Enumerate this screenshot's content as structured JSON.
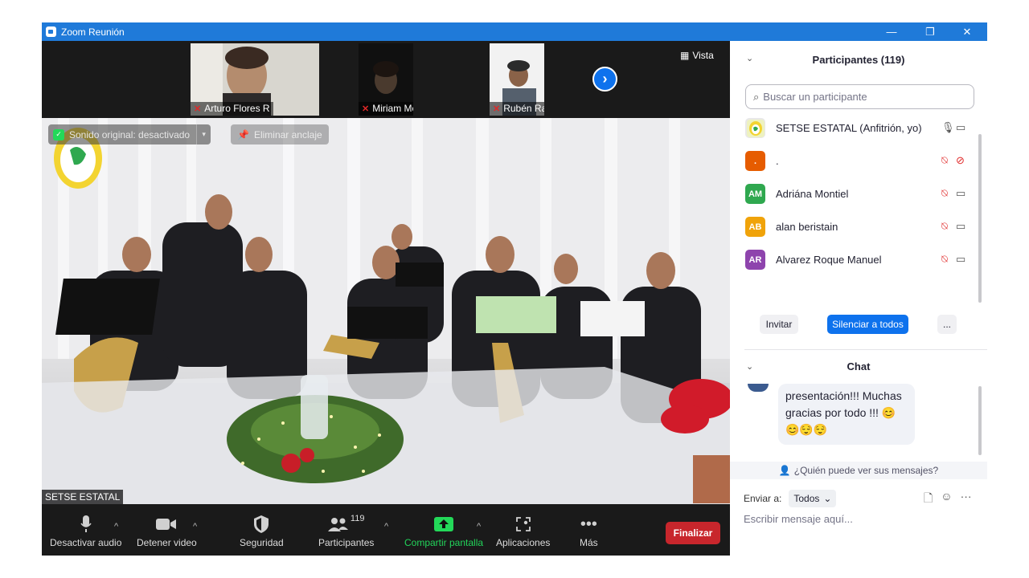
{
  "window": {
    "title": "Zoom Reunión",
    "minimize": "—",
    "restore": "❐",
    "close": "✕"
  },
  "gallery_strip": {
    "tiles": [
      {
        "name": "Arturo Flores R"
      },
      {
        "name": "Miriam Meza"
      },
      {
        "name": "Rubén Ramírez"
      }
    ],
    "next_arrow": "›",
    "view_label": "Vista"
  },
  "main_video": {
    "speaker_name": "SETSE ESTATAL",
    "sound_pill": "Sonido original: desactivado",
    "unpin_label": "Eliminar anclaje"
  },
  "toolbar": {
    "mute": "Desactivar audio",
    "video": "Detener video",
    "security": "Seguridad",
    "participants": "Participantes",
    "participants_count": "119",
    "share": "Compartir pantalla",
    "apps": "Aplicaciones",
    "more": "Más",
    "end": "Finalizar"
  },
  "participants_panel": {
    "header": "Participantes (119)",
    "search_placeholder": "Buscar un participante",
    "rows": [
      {
        "initials": "",
        "name": "SETSE ESTATAL (Anfitrión, yo)",
        "color": "#e8e8e8",
        "mic_muted": false,
        "video_off": false
      },
      {
        "initials": ".",
        "name": ".",
        "color": "#e65c00",
        "mic_muted": true,
        "video_off": true
      },
      {
        "initials": "AM",
        "name": "Adriána Montiel",
        "color": "#2fa84f",
        "mic_muted": true,
        "video_off": false
      },
      {
        "initials": "AB",
        "name": "alan beristain",
        "color": "#f0a30a",
        "mic_muted": true,
        "video_off": false
      },
      {
        "initials": "AR",
        "name": "Alvarez Roque Manuel",
        "color": "#8e44ad",
        "mic_muted": true,
        "video_off": false
      }
    ],
    "invite": "Invitar",
    "mute_all": "Silenciar a todos",
    "more": "..."
  },
  "chat_panel": {
    "header": "Chat",
    "message_line1": "presentación!!! Muchas",
    "message_line2": "gracias por todo !!! 😊",
    "message_line3": "😊😌😌",
    "who_sees": "¿Quién puede ver sus mensajes?",
    "send_to_label": "Enviar a:",
    "send_to_value": "Todos",
    "input_placeholder": "Escribir mensaje aquí..."
  },
  "colors": {
    "titlebar": "#1f7ad9",
    "accent_blue": "#0e72ed",
    "end_red": "#c8262c",
    "share_green": "#23d959",
    "muted_red": "#e02828"
  }
}
